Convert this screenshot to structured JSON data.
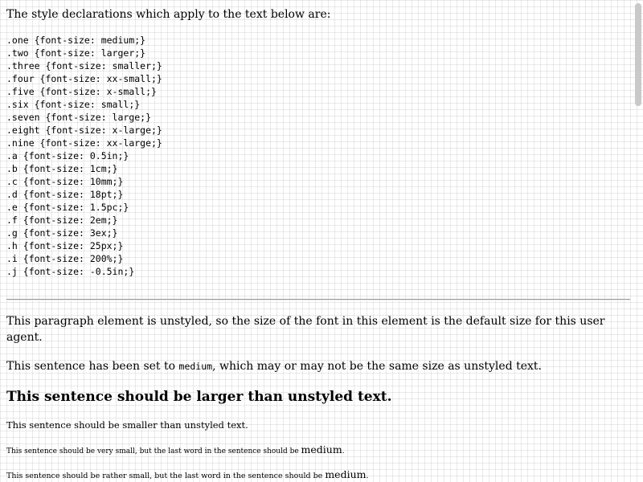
{
  "intro": "The style declarations which apply to the text below are:",
  "css_rules": [
    ".one {font-size: medium;}",
    ".two {font-size: larger;}",
    ".three {font-size: smaller;}",
    ".four {font-size: xx-small;}",
    ".five {font-size: x-small;}",
    ".six {font-size: small;}",
    ".seven {font-size: large;}",
    ".eight {font-size: x-large;}",
    ".nine {font-size: xx-large;}",
    ".a {font-size: 0.5in;}",
    ".b {font-size: 1cm;}",
    ".c {font-size: 10mm;}",
    ".d {font-size: 18pt;}",
    ".e {font-size: 1.5pc;}",
    ".f {font-size: 2em;}",
    ".g {font-size: 3ex;}",
    ".h {font-size: 25px;}",
    ".i {font-size: 200%;}",
    ".j {font-size: -0.5in;}"
  ],
  "paragraphs": {
    "default": "This paragraph element is unstyled, so the size of the font in this element is the default size for this user agent.",
    "one_before": "This sentence has been set to ",
    "one_code": "medium",
    "one_after": ", which may or may not be the same size as unstyled text.",
    "two": "This sentence should be larger than unstyled text.",
    "three": "This sentence should be smaller than unstyled text.",
    "four_before": "This sentence should be very small, but the last word in the sentence should be ",
    "four_medium": "medium",
    "four_after": ".",
    "five_before": "This sentence should be rather small, but the last word in the sentence should be ",
    "five_medium": "medium",
    "five_after": "."
  }
}
